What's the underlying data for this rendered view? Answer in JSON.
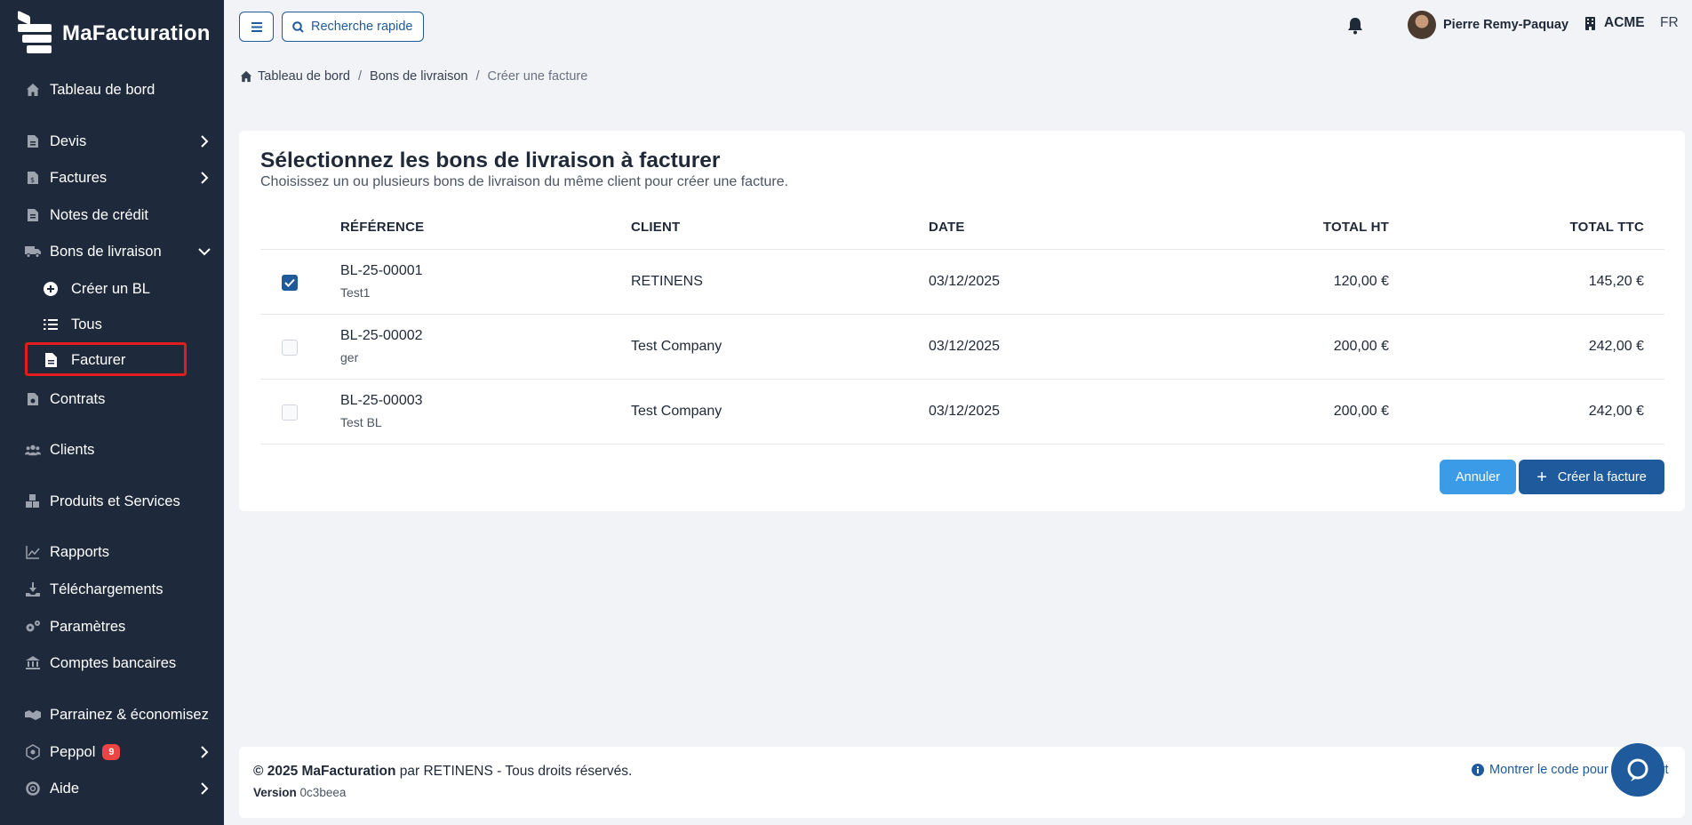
{
  "app": {
    "name": "MaFacturation"
  },
  "sidebar": {
    "items": [
      {
        "label": "Tableau de bord",
        "icon": "home-icon"
      },
      {
        "label": "Devis",
        "icon": "document-icon"
      },
      {
        "label": "Factures",
        "icon": "invoice-icon"
      },
      {
        "label": "Notes de crédit",
        "icon": "credit-note-icon"
      },
      {
        "label": "Bons de livraison",
        "icon": "truck-icon"
      },
      {
        "label": "Contrats",
        "icon": "contract-icon"
      },
      {
        "label": "Clients",
        "icon": "users-icon"
      },
      {
        "label": "Produits et Services",
        "icon": "boxes-icon"
      },
      {
        "label": "Rapports",
        "icon": "chart-icon"
      },
      {
        "label": "Téléchargements",
        "icon": "download-icon"
      },
      {
        "label": "Paramètres",
        "icon": "gears-icon"
      },
      {
        "label": "Comptes bancaires",
        "icon": "bank-icon"
      },
      {
        "label": "Parrainez & économisez",
        "icon": "handshake-icon"
      },
      {
        "label": "Peppol",
        "icon": "network-icon",
        "badge": "9"
      },
      {
        "label": "Aide",
        "icon": "help-icon"
      }
    ],
    "subitems": [
      {
        "label": "Créer un BL",
        "icon": "plus-circle-icon"
      },
      {
        "label": "Tous",
        "icon": "list-icon"
      },
      {
        "label": "Facturer",
        "icon": "file-icon"
      }
    ]
  },
  "topbar": {
    "search_label": "Recherche rapide",
    "user_name": "Pierre Remy-Paquay",
    "company": "ACME",
    "lang": "FR"
  },
  "breadcrumb": {
    "home": "Tableau de bord",
    "section": "Bons de livraison",
    "current": "Créer une facture"
  },
  "card": {
    "title": "Sélectionnez les bons de livraison à facturer",
    "subtitle": "Choisissez un ou plusieurs bons de livraison du même client pour créer une facture.",
    "columns": [
      "RÉFÉRENCE",
      "CLIENT",
      "DATE",
      "TOTAL HT",
      "TOTAL TTC"
    ],
    "rows": [
      {
        "ref": "BL-25-00001",
        "note": "Test1",
        "client": "RETINENS",
        "date": "03/12/2025",
        "total_ht": "120,00 €",
        "total_ttc": "145,20 €",
        "checked": true
      },
      {
        "ref": "BL-25-00002",
        "note": "ger",
        "client": "Test Company",
        "date": "03/12/2025",
        "total_ht": "200,00 €",
        "total_ttc": "242,00 €",
        "checked": false
      },
      {
        "ref": "BL-25-00003",
        "note": "Test BL",
        "client": "Test Company",
        "date": "03/12/2025",
        "total_ht": "200,00 €",
        "total_ttc": "242,00 €",
        "checked": false
      }
    ],
    "cancel_label": "Annuler",
    "create_label": "Créer la facture"
  },
  "footer": {
    "year_brand": "© 2025 MaFacturation",
    "by": " par RETINENS - Tous droits réservés.",
    "version_label": "Version",
    "version_value": "0c3beea",
    "link_label": "Montrer le code pour le support"
  },
  "colors": {
    "sidebar": "#1e293b",
    "primary": "#1e5a9c",
    "secondary": "#3b9be6",
    "highlight": "#e11d1d",
    "badge": "#ef4444"
  }
}
